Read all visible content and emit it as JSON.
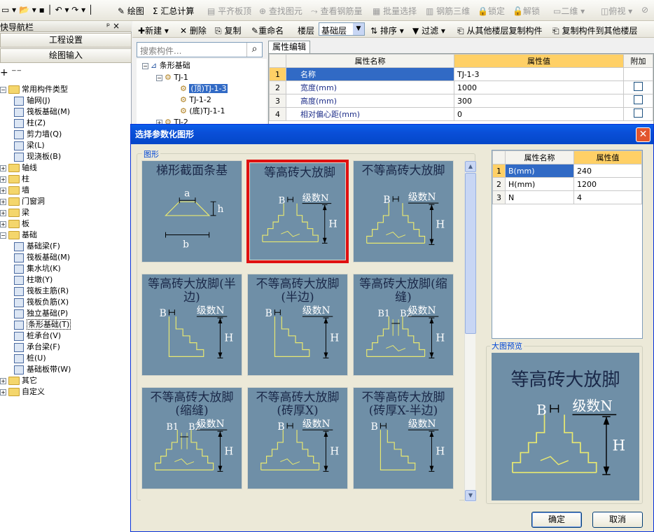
{
  "toolbar1": {
    "draw": "绘图",
    "sum": "Σ 汇总计算",
    "align_top": "平齐板顶",
    "find_elem": "查找图元",
    "view_rebar": "查看钢筋量",
    "batch_select": "批量选择",
    "rebar_3d": "钢筋三维",
    "lock": "锁定",
    "unlock": "解锁",
    "view_2d": "二维",
    "view_top": "俯视"
  },
  "nav": {
    "title": "快导航栏",
    "pin": "ᵖ ×",
    "btn_project": "工程设置",
    "btn_draw": "绘图输入",
    "tree": [
      {
        "label": "常用构件类型",
        "level": 0,
        "kind": "folder",
        "expanded": true
      },
      {
        "label": "轴网(J)",
        "level": 1,
        "kind": "item"
      },
      {
        "label": "筏板基础(M)",
        "level": 1,
        "kind": "item"
      },
      {
        "label": "柱(Z)",
        "level": 1,
        "kind": "item"
      },
      {
        "label": "剪力墙(Q)",
        "level": 1,
        "kind": "item"
      },
      {
        "label": "梁(L)",
        "level": 1,
        "kind": "item"
      },
      {
        "label": "现浇板(B)",
        "level": 1,
        "kind": "item"
      },
      {
        "label": "轴线",
        "level": 0,
        "kind": "folder",
        "expanded": false
      },
      {
        "label": "柱",
        "level": 0,
        "kind": "folder",
        "expanded": false
      },
      {
        "label": "墙",
        "level": 0,
        "kind": "folder",
        "expanded": false
      },
      {
        "label": "门窗洞",
        "level": 0,
        "kind": "folder",
        "expanded": false
      },
      {
        "label": "梁",
        "level": 0,
        "kind": "folder",
        "expanded": false
      },
      {
        "label": "板",
        "level": 0,
        "kind": "folder",
        "expanded": false
      },
      {
        "label": "基础",
        "level": 0,
        "kind": "folder",
        "expanded": true
      },
      {
        "label": "基础梁(F)",
        "level": 1,
        "kind": "item"
      },
      {
        "label": "筏板基础(M)",
        "level": 1,
        "kind": "item"
      },
      {
        "label": "集水坑(K)",
        "level": 1,
        "kind": "item"
      },
      {
        "label": "柱墩(Y)",
        "level": 1,
        "kind": "item"
      },
      {
        "label": "筏板主筋(R)",
        "level": 1,
        "kind": "item"
      },
      {
        "label": "筏板负筋(X)",
        "level": 1,
        "kind": "item"
      },
      {
        "label": "独立基础(P)",
        "level": 1,
        "kind": "item"
      },
      {
        "label": "条形基础(T)",
        "level": 1,
        "kind": "item",
        "selected": true
      },
      {
        "label": "桩承台(V)",
        "level": 1,
        "kind": "item"
      },
      {
        "label": "承台梁(F)",
        "level": 1,
        "kind": "item"
      },
      {
        "label": "桩(U)",
        "level": 1,
        "kind": "item"
      },
      {
        "label": "基础板带(W)",
        "level": 1,
        "kind": "item"
      },
      {
        "label": "其它",
        "level": 0,
        "kind": "folder",
        "expanded": false
      },
      {
        "label": "自定义",
        "level": 0,
        "kind": "folder",
        "expanded": false
      }
    ]
  },
  "toolbar2": {
    "new": "新建",
    "delete": "删除",
    "copy": "复制",
    "rename": "重命名",
    "floor": "楼层",
    "floor_value": "基础层",
    "sort": "排序",
    "filter": "过滤",
    "copy_from": "从其他楼层复制构件",
    "copy_to": "复制构件到其他楼层"
  },
  "component_tree": {
    "search_placeholder": "搜索构件...",
    "root": "条形基础",
    "group": "TJ-1",
    "items": [
      "(顶)TJ-1-3",
      "TJ-1-2",
      "(底)TJ-1-1"
    ],
    "next_group": "TJ-2"
  },
  "property_editor": {
    "tab": "属性编辑",
    "headers": [
      "属性名称",
      "属性值",
      "附加"
    ],
    "rows": [
      {
        "no": "1",
        "name": "名称",
        "value": "TJ-1-3"
      },
      {
        "no": "2",
        "name": "宽度(mm)",
        "value": "1000"
      },
      {
        "no": "3",
        "name": "高度(mm)",
        "value": "300"
      },
      {
        "no": "4",
        "name": "相对偏心距(mm)",
        "value": "0"
      }
    ]
  },
  "dialog": {
    "title": "选择参数化图形",
    "close": "✕",
    "shapes_group": "图形",
    "preview_group": "大图预览",
    "ok": "确定",
    "cancel": "取消",
    "tiles": [
      {
        "title": "梯形截面条基",
        "labels": [
          "a",
          "h",
          "b"
        ]
      },
      {
        "title": "等高砖大放脚",
        "labels": [
          "B",
          "级数N",
          "H"
        ],
        "selected": true
      },
      {
        "title": "不等高砖大放脚",
        "labels": [
          "B",
          "级数N",
          "H"
        ]
      },
      {
        "title": "等高砖大放脚(半边)",
        "labels": [
          "B",
          "级数N",
          "H"
        ]
      },
      {
        "title": "不等高砖大放脚(半边)",
        "labels": [
          "B",
          "级数N",
          "H"
        ]
      },
      {
        "title": "等高砖大放脚(缩缝)",
        "labels": [
          "B1",
          "B2",
          "级数N",
          "H"
        ]
      },
      {
        "title": "不等高砖大放脚(缩缝)",
        "labels": [
          "B1",
          "B2",
          "级数N",
          "H"
        ]
      },
      {
        "title": "不等高砖大放脚(砖厚X)",
        "labels": [
          "B",
          "级数N",
          "H"
        ]
      },
      {
        "title": "不等高砖大放脚(砖厚X-半边)",
        "labels": [
          "B",
          "级数N",
          "H"
        ]
      }
    ],
    "params": {
      "headers": [
        "属性名称",
        "属性值"
      ],
      "rows": [
        {
          "no": "1",
          "name": "B(mm)",
          "value": "240"
        },
        {
          "no": "2",
          "name": "H(mm)",
          "value": "1200"
        },
        {
          "no": "3",
          "name": "N",
          "value": "4"
        }
      ]
    },
    "preview": {
      "title": "等高砖大放脚",
      "labels": [
        "B",
        "级数N",
        "H"
      ]
    }
  },
  "colors": {
    "tile_bg": "#6f8fa7",
    "line_yellow": "#e8e870",
    "select_red": "#e01010",
    "title_blue": "#0a4fd8"
  }
}
